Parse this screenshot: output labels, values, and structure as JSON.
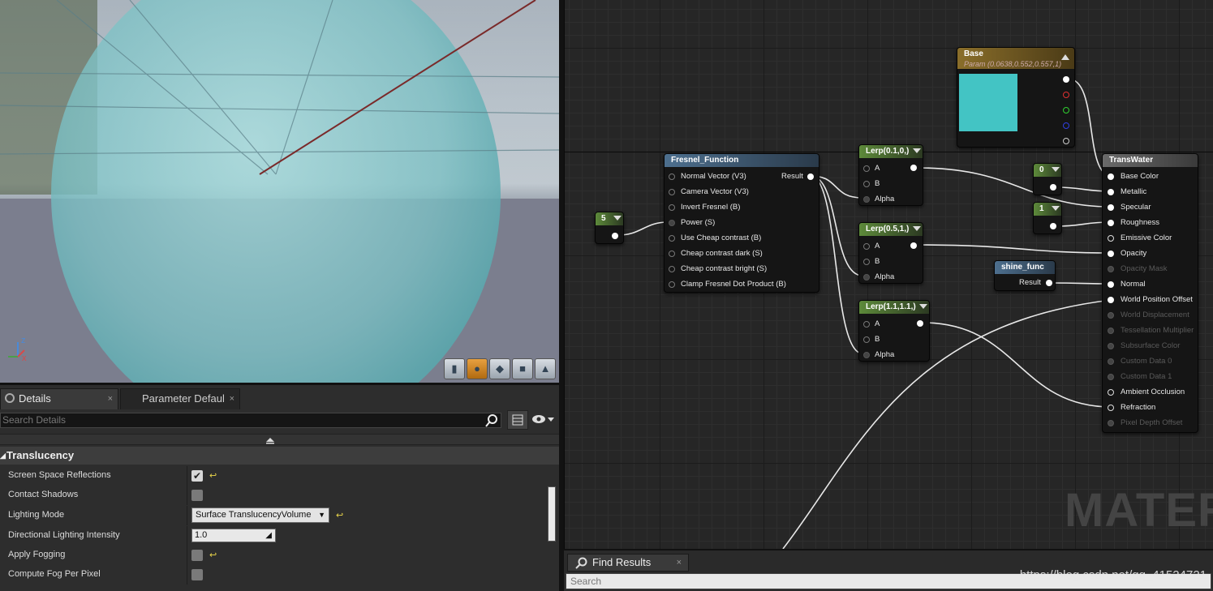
{
  "details_panel": {
    "tabs": [
      {
        "label": "Details",
        "close": "×"
      },
      {
        "label": "Parameter Defaults",
        "close": "×"
      }
    ],
    "search_placeholder": "Search Details",
    "category": "Translucency",
    "properties": [
      {
        "label": "Screen Space Reflections",
        "type": "checkbox",
        "checked": true,
        "reset": true
      },
      {
        "label": "Contact Shadows",
        "type": "checkbox",
        "checked": false,
        "reset": false
      },
      {
        "label": "Lighting Mode",
        "type": "dropdown",
        "value": "Surface TranslucencyVolume",
        "reset": true
      },
      {
        "label": "Directional Lighting Intensity",
        "type": "number",
        "value": "1.0",
        "reset": false
      },
      {
        "label": "Apply Fogging",
        "type": "checkbox",
        "checked": false,
        "reset": true
      },
      {
        "label": "Compute Fog Per Pixel",
        "type": "checkbox",
        "checked": false,
        "reset": false
      }
    ]
  },
  "graph": {
    "nodes": {
      "base": {
        "title": "Base",
        "subtitle": "Param (0.0638,0.552,0.557,1)",
        "color": "#43c4c4"
      },
      "fresnel": {
        "title": "Fresnel_Function",
        "inputs": [
          "Normal Vector (V3)",
          "Camera Vector (V3)",
          "Invert Fresnel (B)",
          "Power (S)",
          "Use Cheap contrast (B)",
          "Cheap contrast dark (S)",
          "Cheap contrast bright (S)",
          "Clamp Fresnel Dot Product (B)"
        ],
        "output": "Result"
      },
      "const5": {
        "title": "5"
      },
      "lerp1": {
        "title": "Lerp(0.1,0,)",
        "pins": [
          "A",
          "B",
          "Alpha"
        ]
      },
      "lerp2": {
        "title": "Lerp(0.5,1,)",
        "pins": [
          "A",
          "B",
          "Alpha"
        ]
      },
      "lerp3": {
        "title": "Lerp(1.1,1.1,)",
        "pins": [
          "A",
          "B",
          "Alpha"
        ]
      },
      "const0": {
        "title": "0"
      },
      "const1": {
        "title": "1"
      },
      "shine": {
        "title": "shine_func",
        "output": "Result"
      },
      "transwater": {
        "title": "TransWater",
        "pins": [
          {
            "label": "Base Color",
            "active": true
          },
          {
            "label": "Metallic",
            "active": true
          },
          {
            "label": "Specular",
            "active": true
          },
          {
            "label": "Roughness",
            "active": true
          },
          {
            "label": "Emissive Color",
            "active": true
          },
          {
            "label": "Opacity",
            "active": true
          },
          {
            "label": "Opacity Mask",
            "active": false
          },
          {
            "label": "Normal",
            "active": true
          },
          {
            "label": "World Position Offset",
            "active": true
          },
          {
            "label": "World Displacement",
            "active": false
          },
          {
            "label": "Tessellation Multiplier",
            "active": false
          },
          {
            "label": "Subsurface Color",
            "active": false
          },
          {
            "label": "Custom Data 0",
            "active": false
          },
          {
            "label": "Custom Data 1",
            "active": false
          },
          {
            "label": "Ambient Occlusion",
            "active": true
          },
          {
            "label": "Refraction",
            "active": true
          },
          {
            "label": "Pixel Depth Offset",
            "active": false
          }
        ]
      }
    },
    "watermark": "MATERI"
  },
  "find_results": {
    "tab_label": "Find Results",
    "close": "×",
    "search_placeholder": "Search"
  },
  "overlay_text": "https://blog.csdn.net/qq_41524721"
}
